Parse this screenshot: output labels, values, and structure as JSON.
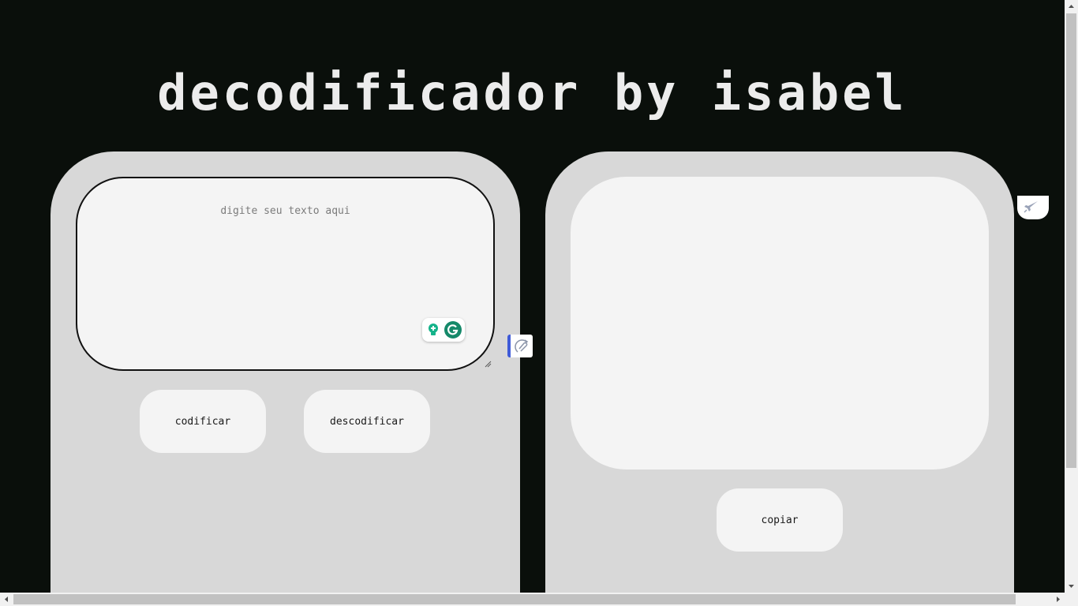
{
  "header": {
    "title": "decodificador by isabel"
  },
  "input": {
    "placeholder": "digite seu texto aqui",
    "value": ""
  },
  "buttons": {
    "encode_label": "codificar",
    "decode_label": "descodificar",
    "copy_label": "copiar"
  },
  "output": {
    "text": ""
  },
  "icons": {
    "grammarly_bulb": "lightbulb-icon",
    "grammarly_logo": "grammarly-icon",
    "extension": "paperclip-sync-icon",
    "rocket": "rocket-icon"
  },
  "colors": {
    "background": "#0a0f0b",
    "panel": "#d8d8d8",
    "field": "#f4f4f4",
    "title": "#ececec",
    "grammarly": "#15896a",
    "extension_accent": "#3f5bd8"
  }
}
